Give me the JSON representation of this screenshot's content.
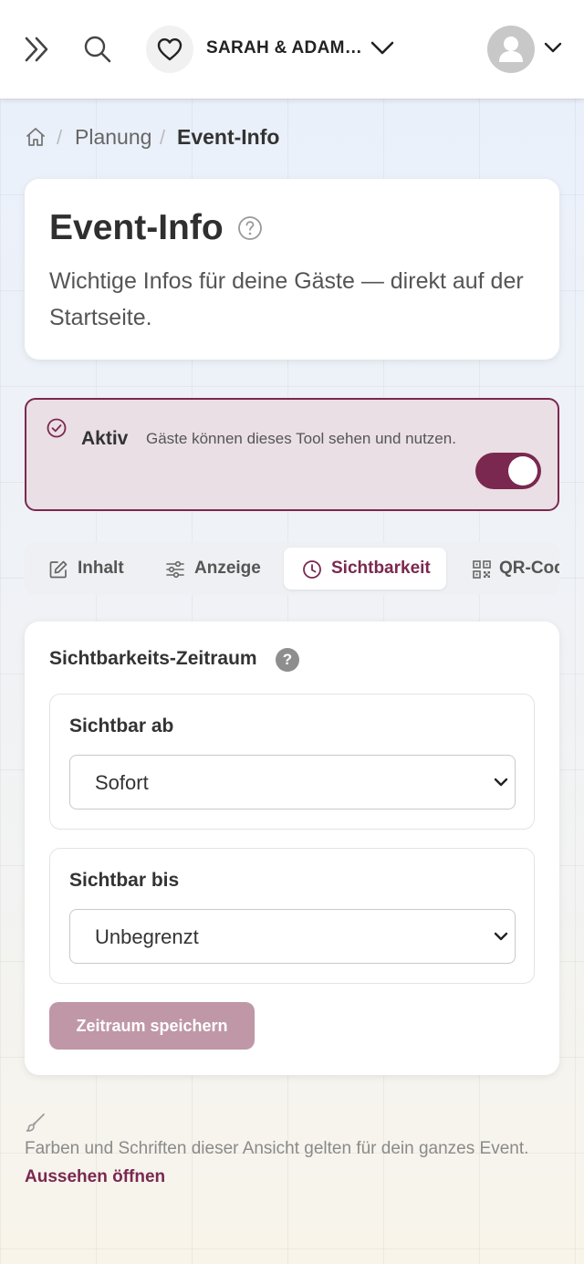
{
  "header": {
    "event_name": "SARAH & ADAM…"
  },
  "breadcrumb": {
    "items": [
      "Planung",
      "Event-Info"
    ],
    "separator": "/"
  },
  "intro": {
    "title": "Event-Info",
    "subtitle": "Wichtige Infos für deine Gäste — direkt auf der Startseite."
  },
  "status": {
    "label": "Aktiv",
    "description": "Gäste können dieses Tool sehen und nutzen.",
    "enabled": true
  },
  "tabs": {
    "items": [
      {
        "label": "Inhalt",
        "icon": "edit-icon"
      },
      {
        "label": "Anzeige",
        "icon": "sliders-icon"
      },
      {
        "label": "Sichtbarkeit",
        "icon": "clock-icon"
      },
      {
        "label": "QR-Code",
        "icon": "qr-code-icon"
      }
    ],
    "active": "Sichtbarkeit"
  },
  "visibility": {
    "section_title": "Sichtbarkeits-Zeitraum",
    "help_symbol": "?",
    "from_label": "Sichtbar ab",
    "from_value": "Sofort",
    "until_label": "Sichtbar bis",
    "until_value": "Unbegrenzt",
    "save_label": "Zeitraum speichern"
  },
  "footer": {
    "note": "Farben und Schriften dieser Ansicht gelten für dein ganzes Event.",
    "link": "Aussehen öffnen"
  },
  "colors": {
    "accent": "#7a2850",
    "accent_light": "#eadfe4",
    "button_disabled": "#bf97a6"
  }
}
